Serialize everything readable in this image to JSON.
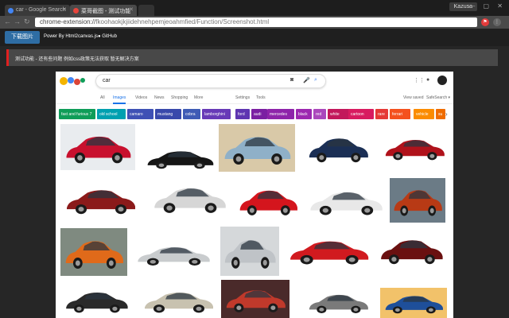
{
  "browser": {
    "tabs": [
      {
        "title": "car - Google Search",
        "favicon_color": "#4285f4"
      },
      {
        "title": "菜哥截图 - 测试功能",
        "favicon_color": "#e8453c"
      }
    ],
    "user": "Kazusa",
    "url": {
      "scheme": "chrome-extension://",
      "path": "fkoohaokjkjiidehnehpemjeoahmfied/Function/Screenshot.html"
    }
  },
  "toolbar": {
    "download_label": "下载图片",
    "powered_by": "Power By Html2canvas.js",
    "github_label": "GitHub"
  },
  "notice": {
    "text": "测试功能 - 还有些问题 例如css政策无法获取 暂无解决方案"
  },
  "google": {
    "query": "car",
    "tabs": [
      "All",
      "Images",
      "Videos",
      "News",
      "Shopping",
      "More"
    ],
    "right_tabs": [
      "Settings",
      "Tools"
    ],
    "view_saved": "View saved",
    "safesearch": "SafeSearch ▾",
    "chips": [
      {
        "label": "fast and furious 7",
        "color": "#0f9d58"
      },
      {
        "label": "old school",
        "color": "#00a0b0"
      },
      {
        "label": "camaro",
        "color": "#3f51b5"
      },
      {
        "label": "mustang",
        "color": "#3949ab"
      },
      {
        "label": "cobra",
        "color": "#3f5bb5"
      },
      {
        "label": "lamborghini",
        "color": "#673ab7"
      },
      {
        "label": "ford",
        "color": "#5e35b1"
      },
      {
        "label": "audi",
        "color": "#7b1fa2"
      },
      {
        "label": "mercedes",
        "color": "#8e24aa"
      },
      {
        "label": "black",
        "color": "#9c27b0"
      },
      {
        "label": "red",
        "color": "#ab47bc"
      },
      {
        "label": "white",
        "color": "#c2185b"
      },
      {
        "label": "cartoon",
        "color": "#d81b60"
      },
      {
        "label": "rare",
        "color": "#e53935"
      },
      {
        "label": "ferrari",
        "color": "#f4511e"
      },
      {
        "label": "vehicle",
        "color": "#fb8c00"
      },
      {
        "label": "su",
        "color": "#ef6c00"
      }
    ]
  },
  "images": [
    {
      "color": "#c8102e",
      "bg": "#e9ecef"
    },
    {
      "color": "#151515",
      "bg": "#ffffff"
    },
    {
      "color": "#8fb0c8",
      "bg": "#d9c9a8"
    },
    {
      "color": "#1b2f55",
      "bg": "#ffffff"
    },
    {
      "color": "#b0121b",
      "bg": "#ffffff"
    },
    {
      "color": "#8b1a1a",
      "bg": "#ffffff"
    },
    {
      "color": "#d6d6d6",
      "bg": "#ffffff"
    },
    {
      "color": "#d4151d",
      "bg": "#ffffff"
    },
    {
      "color": "#e8e8e8",
      "bg": "#ffffff"
    },
    {
      "color": "#b83a15",
      "bg": "#6b7b86"
    },
    {
      "color": "#e06a1a",
      "bg": "#7f8a80"
    },
    {
      "color": "#c9ccce",
      "bg": "#ffffff"
    },
    {
      "color": "#bfc3c7",
      "bg": "#d5d8da"
    },
    {
      "color": "#d11a1f",
      "bg": "#ffffff"
    },
    {
      "color": "#6a1010",
      "bg": "#ffffff"
    },
    {
      "color": "#2a2a2a",
      "bg": "#ffffff"
    },
    {
      "color": "#c8c2b0",
      "bg": "#ffffff"
    },
    {
      "color": "#c0392b",
      "bg": "#4a2a2a"
    },
    {
      "color": "#7a7a7a",
      "bg": "#ffffff"
    },
    {
      "color": "#1e4f9a",
      "bg": "#f2c26a"
    }
  ]
}
